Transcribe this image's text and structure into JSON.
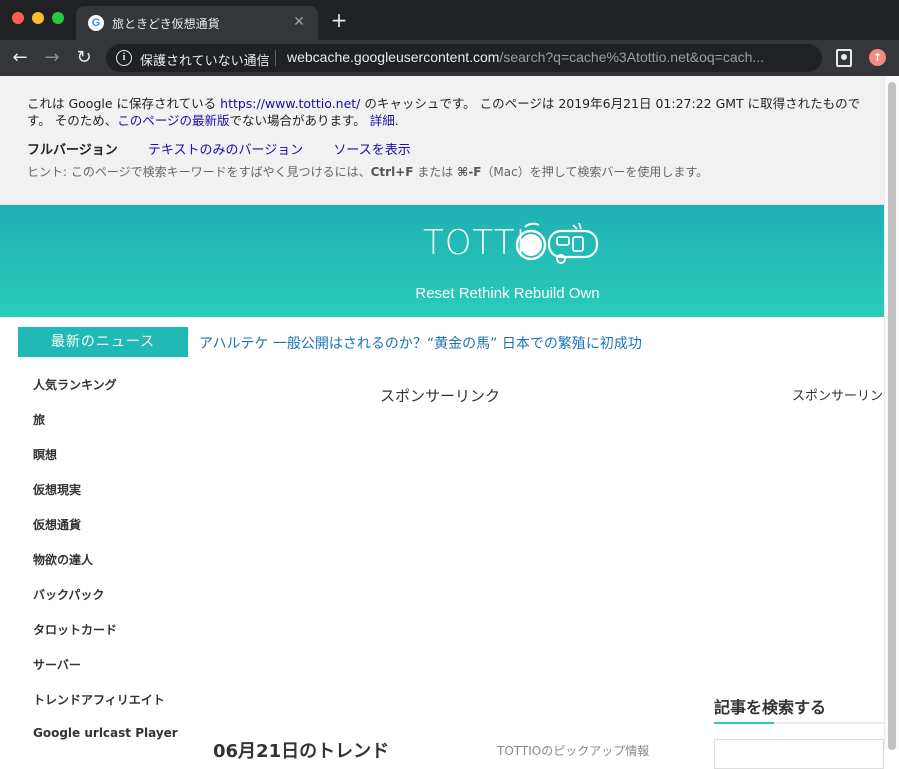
{
  "browser": {
    "tab": {
      "title": "旅ときどき仮想通貨",
      "favicon": "G",
      "close": "✕"
    },
    "new_tab": "+",
    "nav": {
      "back": "←",
      "forward": "→",
      "reload": "↻"
    },
    "omnibox": {
      "security_text": "保護されていない通信",
      "url_host": "webcache.googleusercontent.com",
      "url_path": "/search?q=cache%3Atottio.net&oq=cach..."
    },
    "info_icon": "i",
    "update_icon": "↑"
  },
  "cache_banner": {
    "text_1": "これは Google に保存されている ",
    "cached_url": "https://www.tottio.net/",
    "text_2": " のキャッシュです。 このページは 2019年6月21日 01:27:22 GMT に取得されたものです。 そのため、",
    "latest_link": "このページの最新版",
    "text_3": "でない場合があります。 ",
    "details_link": "詳細.",
    "versions": {
      "full": "フルバージョン",
      "text_only": "テキストのみのバージョン",
      "source": "ソースを表示"
    },
    "hint_1": "ヒント: このページで検索キーワードをすばやく見つけるには、",
    "hint_key_1": "Ctrl+F",
    "hint_2": " または ",
    "hint_key_2": "⌘-F",
    "hint_3": "（Mac）を押して検索バーを使用します。"
  },
  "site": {
    "logo_text": "TOTTI",
    "tagline": "Reset Rethink Rebuild Own",
    "colors": {
      "accent": "#20b9b5",
      "header_top": "#1fb0b4",
      "header_bottom": "#29ccb8",
      "link": "#1a73b8"
    }
  },
  "news": {
    "label": "最新のニュース",
    "headline": "アハルテケ 一般公開はされるのか？“黄金の馬” 日本での繁殖に初成功"
  },
  "sidebar": {
    "items": [
      {
        "label": "人気ランキング"
      },
      {
        "label": "旅"
      },
      {
        "label": "瞑想"
      },
      {
        "label": "仮想現実"
      },
      {
        "label": "仮想通貨"
      },
      {
        "label": "物欲の達人"
      },
      {
        "label": "バックパック"
      },
      {
        "label": "タロットカード"
      },
      {
        "label": "サーバー"
      },
      {
        "label": "トレンドアフィリエイト"
      },
      {
        "label": "Google urlcast Player"
      }
    ]
  },
  "content": {
    "sponsor_label_1": "スポンサーリンク",
    "sponsor_label_2": "スポンサーリンク",
    "trend_title": "06月21日のトレンド",
    "pickup_text": "TOTTIOのピックアップ情報"
  },
  "search_widget": {
    "title": "記事を検索する"
  }
}
